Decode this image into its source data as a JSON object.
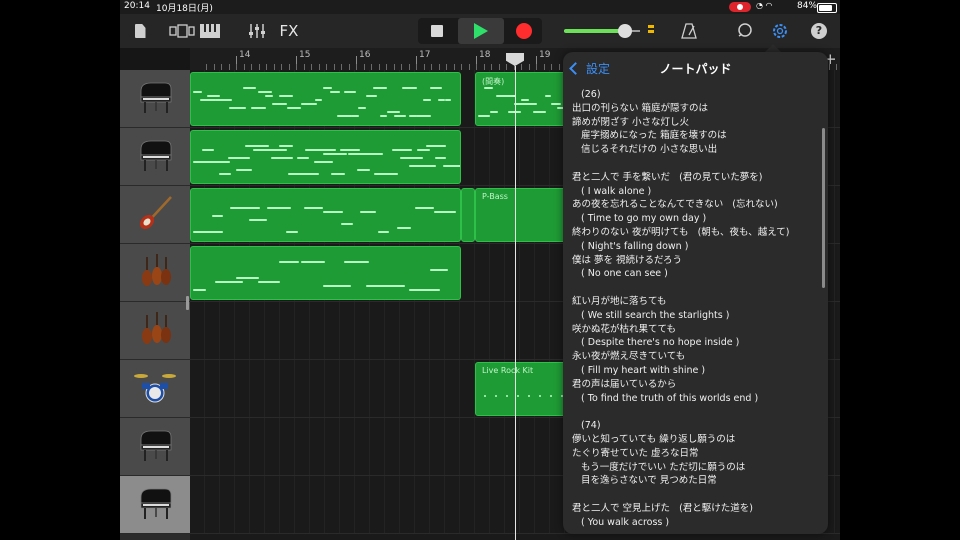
{
  "status_bar": {
    "time": "20:14",
    "date": "10月18日(月)",
    "battery": "84%"
  },
  "toolbar": {
    "fx_label": "FX",
    "volume_level": 0.8
  },
  "ruler": {
    "bars": [
      "14",
      "15",
      "16",
      "17",
      "18",
      "19"
    ]
  },
  "tracks": [
    {
      "name": "grand-piano",
      "icon": "grand-piano-icon"
    },
    {
      "name": "grand-piano",
      "icon": "grand-piano-icon"
    },
    {
      "name": "electric-bass",
      "icon": "bass-guitar-icon"
    },
    {
      "name": "strings",
      "icon": "strings-icon"
    },
    {
      "name": "strings",
      "icon": "strings-icon"
    },
    {
      "name": "drums",
      "icon": "drum-kit-icon"
    },
    {
      "name": "grand-piano",
      "icon": "grand-piano-icon"
    },
    {
      "name": "grand-piano",
      "icon": "grand-piano-icon",
      "selected": true
    }
  ],
  "regions": {
    "interlude": "(間奏)",
    "bass": "P-Bass",
    "drums": "Live Rock Kit"
  },
  "notepad": {
    "back_label": "設定",
    "title": "ノートパッド",
    "lines": [
      "   (26)",
      "出口の刊らない 箱庭が隠すのは",
      "諦めが閉ざす 小さな灯し火",
      "   雇字搦めになった 箱庭を壊すのは",
      "   信じるそれだけの 小さな思い出",
      "",
      "君と二人で 手を繋いだ   (君の見ていた夢を)",
      "   ( I walk alone )",
      "あの夜を忘れることなんてできない   (忘れない)",
      "   ( Time to go my own day )",
      "終わりのない 夜が明けても   (朝も、夜も、越えて)",
      "   ( Night's falling down )",
      "僕は 夢を 視続けるだろう",
      "   ( No one can see )",
      "",
      "紅い月が地に落ちても",
      "   ( We still search the starlights )",
      "咲かぬ花が枯れ果てても",
      "   ( Despite there's no hope inside )",
      "永い夜が燃え尽きていても",
      "   ( Fill my heart with shine )",
      "君の声は届いているから",
      "   ( To find the truth of this worlds end )",
      "",
      "   (74)",
      "儚いと知っていても 繰り返し願うのは",
      "たぐり寄せていた 虚ろな日常",
      "   もう一度だけでいい ただ切に願うのは",
      "   目を逸らさないで 見つめた日常",
      "",
      "君と二人で 空見上げた   (君と駆けた道を)",
      "   ( You walk across )"
    ]
  }
}
